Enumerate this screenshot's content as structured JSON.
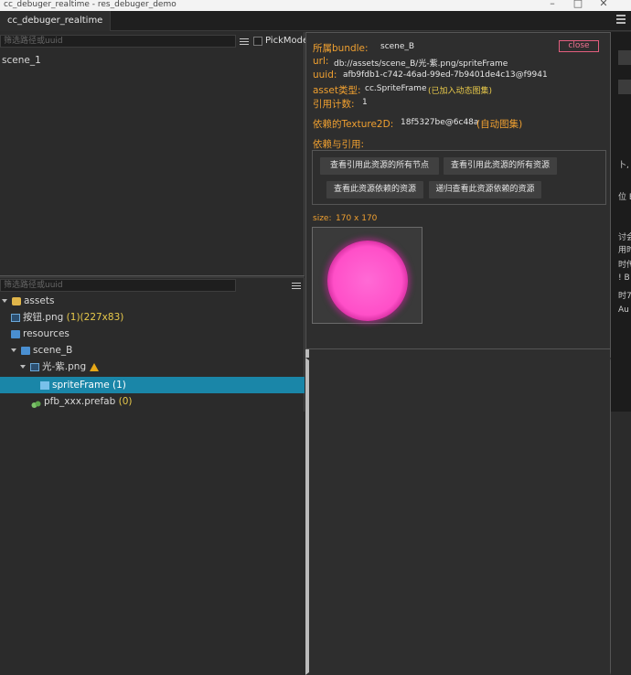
{
  "window": {
    "title": "cc_debuger_realtime - res_debuger_demo",
    "tab": "cc_debuger_realtime"
  },
  "left_top": {
    "filter_placeholder": "筛选路径或uuid",
    "pickmode_label": "PickMode",
    "tree": [
      "scene_1"
    ]
  },
  "left_bottom": {
    "filter_placeholder": "筛选路径或uuid",
    "tree": [
      {
        "label": "assets",
        "count": ""
      },
      {
        "label": "按钮.png",
        "count": "(1)(227x83)"
      },
      {
        "label": "resources",
        "count": ""
      },
      {
        "label": "scene_B",
        "count": ""
      },
      {
        "label": "光-紫.png",
        "count": ""
      },
      {
        "label": "spriteFrame",
        "count": "(1)"
      },
      {
        "label": "pfb_xxx.prefab",
        "count": "(0)"
      }
    ]
  },
  "detail": {
    "bundle_label": "所属bundle:",
    "bundle_value": "scene_B",
    "close_label": "close",
    "url_label": "url:",
    "url_value": "db://assets/scene_B/光-紫.png/spriteFrame",
    "uuid_label": "uuid:",
    "uuid_value": "afb9fdb1-c742-46ad-99ed-7b9401de4c13@f9941",
    "type_label": "asset类型:",
    "type_value": "cc.SpriteFrame",
    "type_note": "(已加入动态图集)",
    "refcount_label": "引用计数:",
    "refcount_value": "1",
    "texture_label": "依赖的Texture2D:",
    "texture_value": "18f5327be@6c48a",
    "texture_note": "(自动图集)",
    "deps_label": "依赖与引用:",
    "buttons": [
      "查看引用此资源的所有节点",
      "查看引用此资源的所有资源",
      "查看此资源依赖的资源",
      "递归查看此资源依赖的资源"
    ],
    "size_label": "size:",
    "size_value": "170 x 170"
  },
  "background_fragments": [
    "卜,",
    "位 E",
    "讨会",
    "用时",
    "时传",
    "! B",
    "时7",
    "Au"
  ],
  "colors": {
    "accent_label": "#f0a030",
    "selection": "#1a86a8",
    "close": "#e35e7e",
    "orb": "#ff4fc8"
  }
}
